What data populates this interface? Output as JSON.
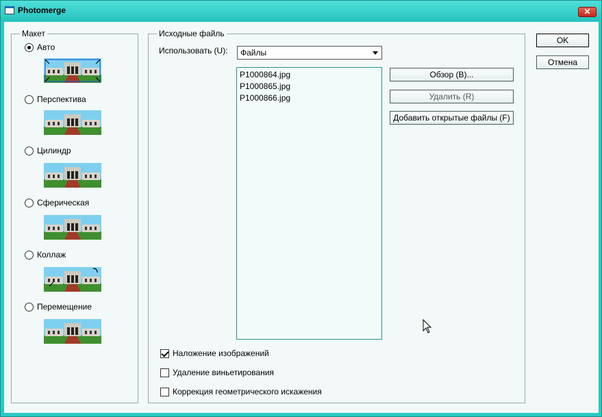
{
  "window": {
    "title": "Photomerge",
    "close_glyph": "✕"
  },
  "layout_group": {
    "legend": "Макет",
    "options": [
      {
        "label": "Авто",
        "selected": true
      },
      {
        "label": "Перспектива",
        "selected": false
      },
      {
        "label": "Цилиндр",
        "selected": false
      },
      {
        "label": "Сферическая",
        "selected": false
      },
      {
        "label": "Коллаж",
        "selected": false
      },
      {
        "label": "Перемещение",
        "selected": false
      }
    ]
  },
  "source_group": {
    "legend": "Исходные файль",
    "use_label": "Использовать (U):",
    "use_value": "Файлы",
    "files": [
      "P1000864.jpg",
      "P1000865.jpg",
      "P1000866.jpg"
    ],
    "browse_label": "Обзор (B)...",
    "remove_label": "Удалить (R)",
    "add_open_label": "Добавить открытые файлы (F)"
  },
  "options": [
    {
      "label": "Наложение изображений",
      "checked": true
    },
    {
      "label": "Удаление виньетирования",
      "checked": false
    },
    {
      "label": "Коррекция геометрического искажения",
      "checked": false
    }
  ],
  "buttons": {
    "ok": "OK",
    "cancel": "Отмена"
  },
  "colors": {
    "accent": "#2bc9c4",
    "client_bg": "#f2f9f8"
  }
}
